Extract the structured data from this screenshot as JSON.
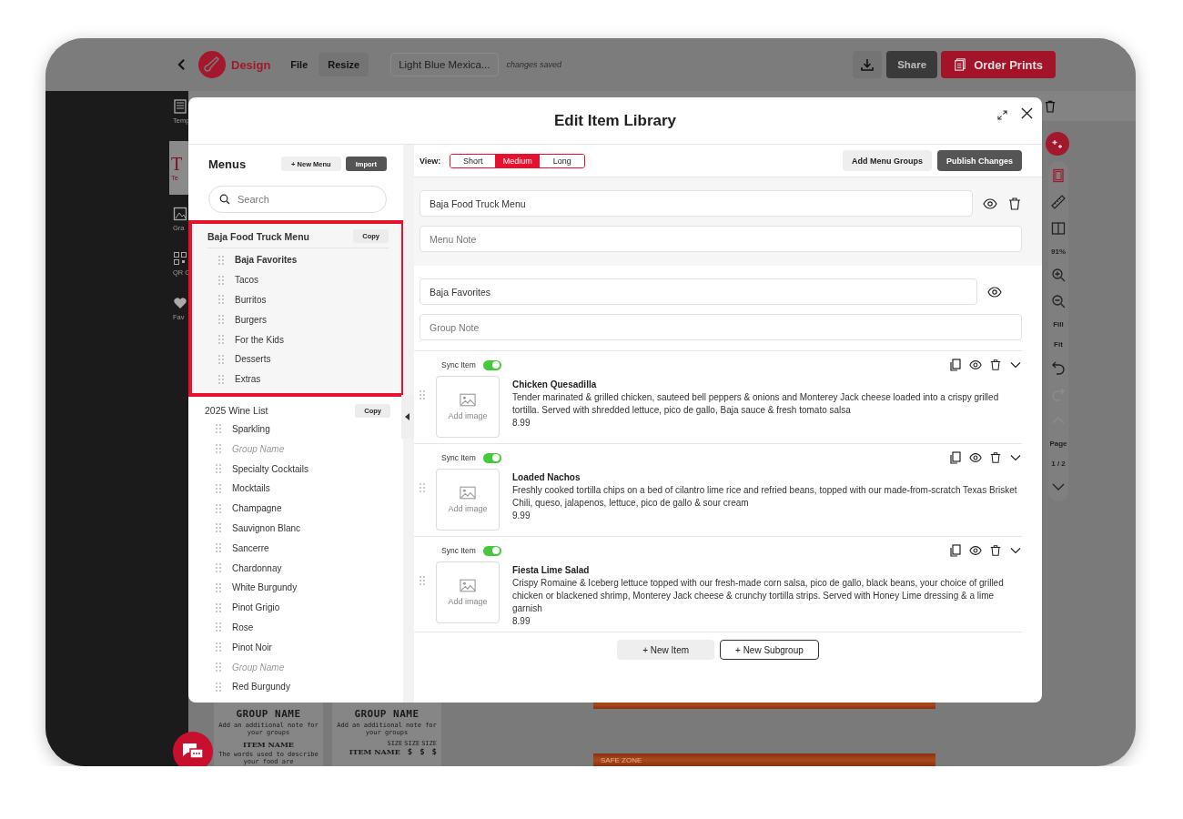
{
  "app_bar": {
    "app_name": "Design",
    "menu": [
      "File",
      "Resize"
    ],
    "document_title": "Light Blue Mexica...",
    "save_status": "changes saved",
    "share": "Share",
    "order_prints": "Order Prints"
  },
  "tool_sidebar": [
    {
      "kind": "templates",
      "label": "Temp",
      "selected": false
    },
    {
      "kind": "text",
      "glyph": "T",
      "label": "Te",
      "selected": true
    },
    {
      "kind": "graphics",
      "label": "Gra",
      "selected": false
    },
    {
      "kind": "qr",
      "label": "QR C",
      "selected": false
    },
    {
      "kind": "favorites",
      "label": "Fav",
      "selected": false
    }
  ],
  "canvas_tools": {
    "zoom": "91%",
    "fill": "Fill",
    "fit": "Fit",
    "page_label": "Page",
    "page": "1 / 2"
  },
  "template_previews": [
    {
      "title": "GROUP NAME",
      "note": "Add an additional note for your groups",
      "item": "ITEM NAME",
      "description": "The words used to describe your food are"
    },
    {
      "title": "GROUP NAME",
      "note": "Add an additional note for your groups",
      "sizes": [
        "SIZE",
        "SIZE",
        "SIZE"
      ],
      "item": "ITEM NAME",
      "prices": [
        "$",
        "$",
        "$"
      ]
    }
  ],
  "safe_zone_label": "SAFE ZONE",
  "modal": {
    "title": "Edit Item Library",
    "menus_panel": {
      "heading": "Menus",
      "new_menu": "+ New Menu",
      "import": "Import",
      "search_placeholder": "Search",
      "menus": [
        {
          "name": "Baja Food Truck Menu",
          "selected": true,
          "copy": "Copy",
          "groups": [
            {
              "name": "Baja Favorites",
              "selected": true
            },
            {
              "name": "Tacos",
              "selected": false
            },
            {
              "name": "Burritos",
              "selected": false
            },
            {
              "name": "Burgers",
              "selected": false
            },
            {
              "name": "For the Kids",
              "selected": false
            },
            {
              "name": "Desserts",
              "selected": false
            },
            {
              "name": "Extras",
              "selected": false
            }
          ]
        },
        {
          "name": "2025 Wine List",
          "selected": false,
          "copy": "Copy",
          "groups": [
            {
              "name": "Sparkling",
              "selected": false
            },
            {
              "placeholder": "Group Name",
              "selected": false
            },
            {
              "name": "Specialty Cocktails",
              "selected": false
            },
            {
              "name": "Mocktails",
              "selected": false
            },
            {
              "name": "Champagne",
              "selected": false
            },
            {
              "name": "Sauvignon Blanc",
              "selected": false
            },
            {
              "name": "Sancerre",
              "selected": false
            },
            {
              "name": "Chardonnay",
              "selected": false
            },
            {
              "name": "White Burgundy",
              "selected": false
            },
            {
              "name": "Pinot Grigio",
              "selected": false
            },
            {
              "name": "Rose",
              "selected": false
            },
            {
              "name": "Pinot Noir",
              "selected": false
            },
            {
              "placeholder": "Group Name",
              "selected": false
            },
            {
              "name": "Red Burgundy",
              "selected": false
            }
          ]
        }
      ]
    },
    "editor": {
      "view_label": "View:",
      "views": [
        {
          "label": "Short",
          "selected": false
        },
        {
          "label": "Medium",
          "selected": true
        },
        {
          "label": "Long",
          "selected": false
        }
      ],
      "add_groups": "Add Menu Groups",
      "publish": "Publish Changes",
      "menu_name": "Baja Food Truck Menu",
      "menu_note_placeholder": "Menu Note",
      "group_name": "Baja Favorites",
      "group_note_placeholder": "Group Note",
      "items": [
        {
          "sync_label": "Sync Item",
          "synced": true,
          "image_label": "Add image",
          "name": "Chicken Quesadilla",
          "description": "Tender marinated & grilled chicken, sauteed bell peppers & onions and Monterey Jack cheese loaded into a crispy grilled tortilla. Served with shredded lettuce, pico de gallo, Baja sauce & fresh tomato salsa",
          "price": "8.99"
        },
        {
          "sync_label": "Sync Item",
          "synced": true,
          "image_label": "Add image",
          "name": "Loaded Nachos",
          "description": "Freshly cooked tortilla chips on a bed of cilantro lime rice and refried beans, topped with our made-from-scratch Texas Brisket Chili, queso, jalapenos, lettuce, pico de gallo & sour cream",
          "price": "9.99"
        },
        {
          "sync_label": "Sync Item",
          "synced": true,
          "image_label": "Add image",
          "name": "Fiesta Lime Salad",
          "description": "Crispy Romaine & Iceberg lettuce topped with our fresh-made corn salsa, pico de gallo, black beans, your choice of grilled chicken or blackened shrimp, Monterey Jack cheese & crunchy tortilla strips. Served with Honey Lime dressing & a lime garnish",
          "price": "8.99"
        }
      ],
      "new_item": "+ New Item",
      "new_subgroup": "+ New Subgroup"
    }
  }
}
